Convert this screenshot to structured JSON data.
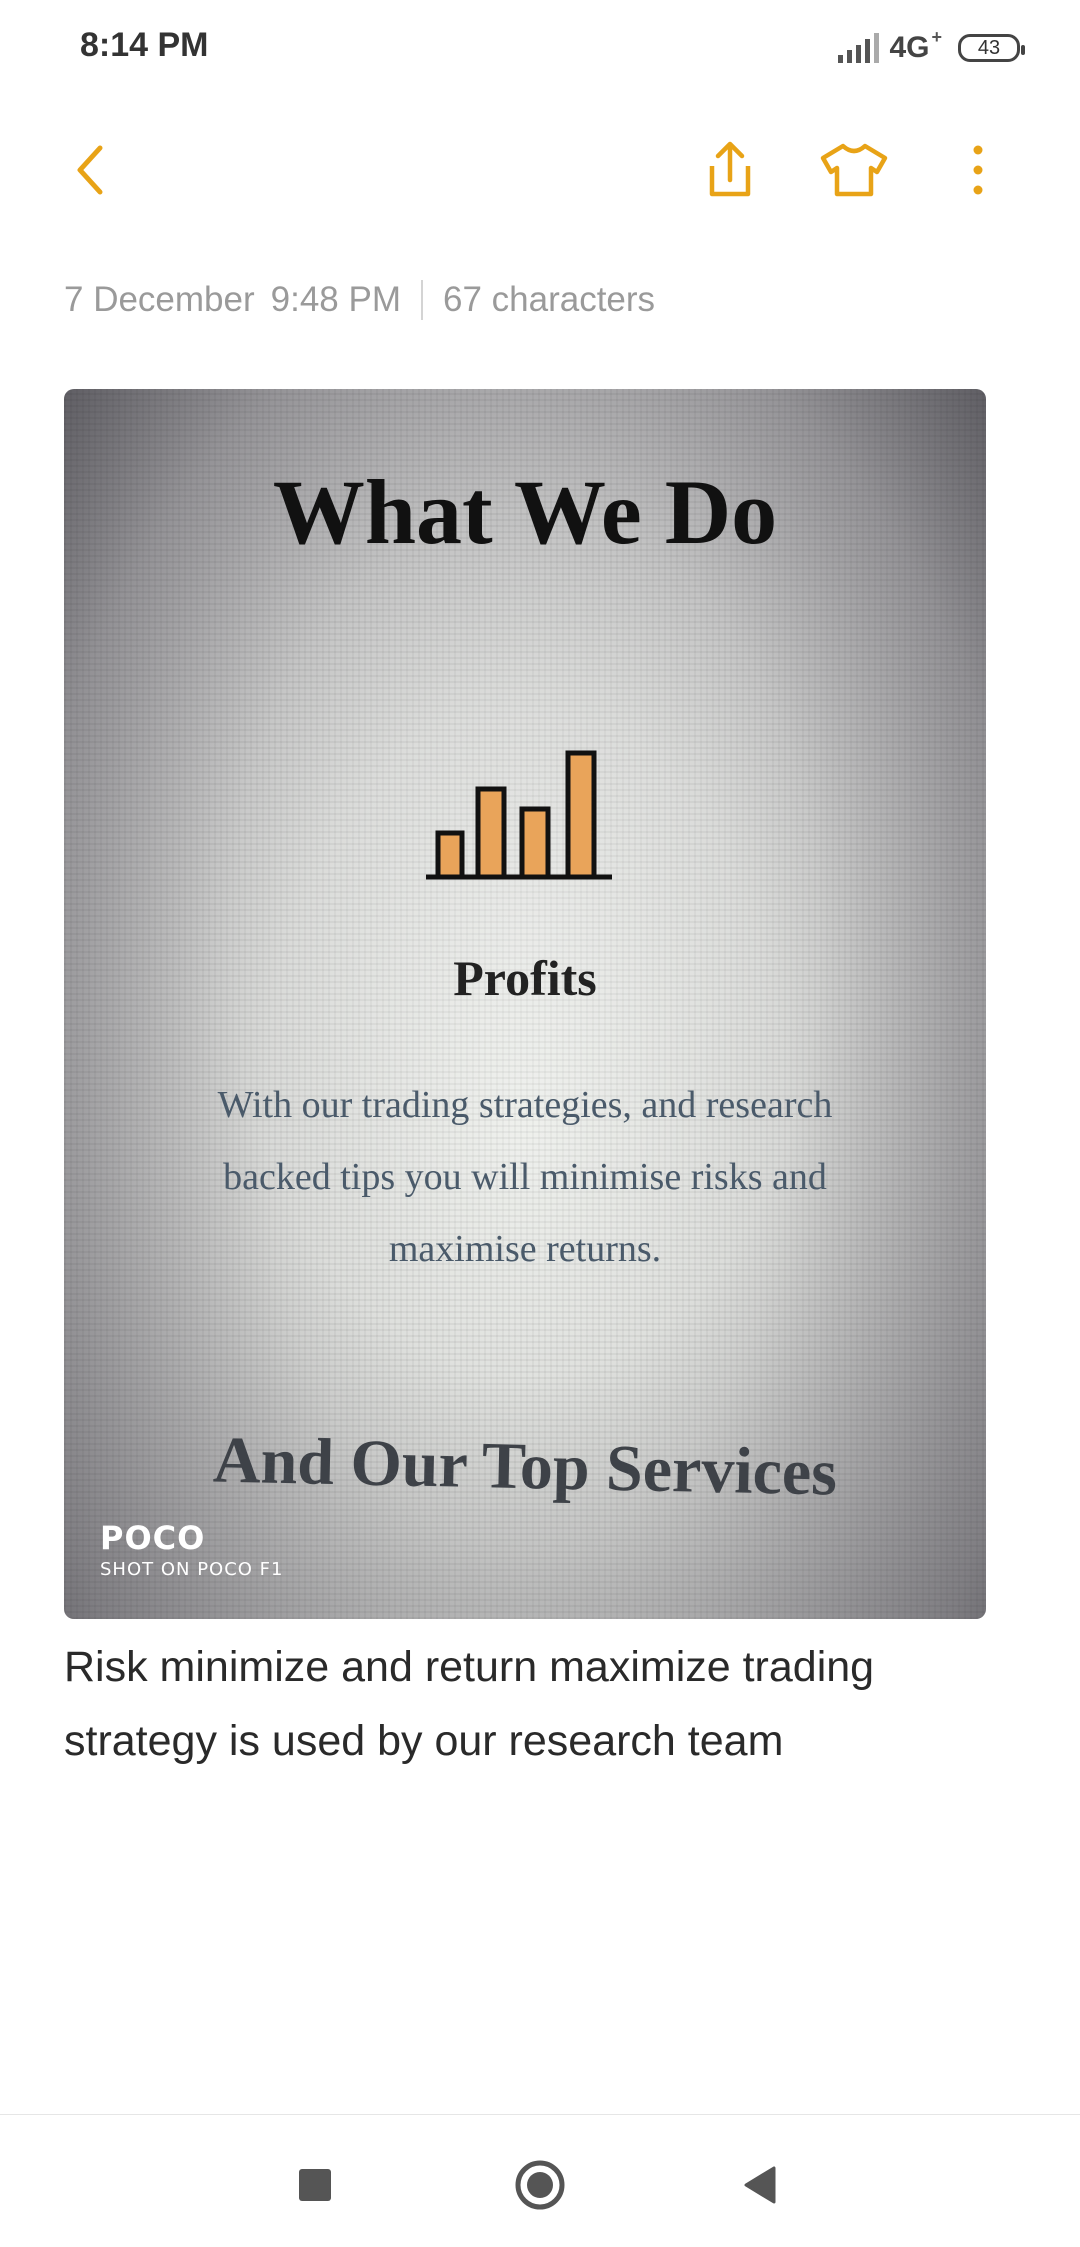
{
  "status_bar": {
    "time": "8:14 PM",
    "network": "4G",
    "network_sup": "+",
    "battery": "43"
  },
  "toolbar": {
    "back_icon": "chevron-left-icon",
    "share_icon": "share-icon",
    "theme_icon": "tshirt-icon",
    "more_icon": "more-vertical-icon",
    "accent_color": "#E8A317"
  },
  "note": {
    "date": "7 December",
    "time": "9:48 PM",
    "characters": "67 characters",
    "text": "Risk minimize and return maximize trading strategy is used by our research team"
  },
  "photo": {
    "title": "What We Do",
    "chart_icon": "bar-chart-icon",
    "subtitle": "Profits",
    "body": "With our trading strategies, and research backed tips you will minimise risks and maximise returns.",
    "services": "And Our Top Services",
    "watermark_brand": "POCO",
    "watermark_shot": "SHOT ON POCO F1"
  },
  "nav_bar": {
    "recents_icon": "square-icon",
    "home_icon": "circle-icon",
    "back_icon": "triangle-back-icon"
  }
}
